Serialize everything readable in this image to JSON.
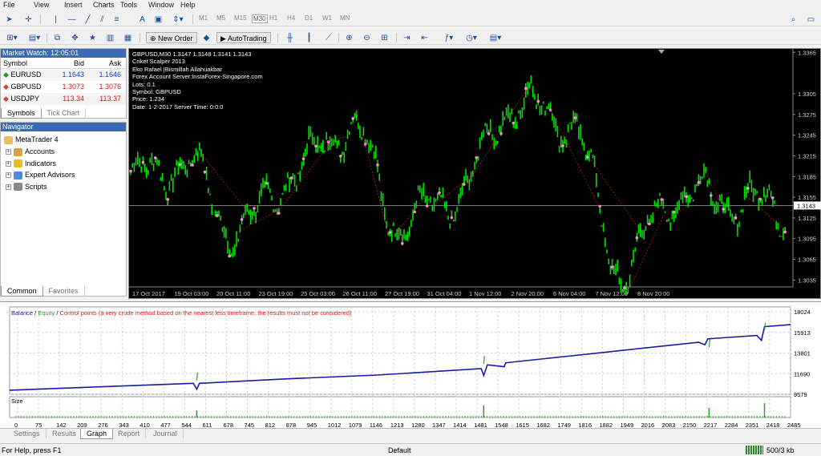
{
  "menu": [
    "File",
    "View",
    "Insert",
    "Charts",
    "Tools",
    "Window",
    "Help"
  ],
  "toolbar": {
    "timeframes": [
      "M1",
      "M5",
      "M15",
      "M30",
      "H1",
      "H4",
      "D1",
      "W1",
      "MN"
    ],
    "selected_timeframe": "M30",
    "new_order_label": "New Order",
    "autotrading_label": "AutoTrading"
  },
  "market_watch": {
    "title": "Market Watch: 12:05:01",
    "columns": [
      "Symbol",
      "Bid",
      "Ask"
    ],
    "rows": [
      {
        "symbol": "EURUSD",
        "bid": "1.1643",
        "ask": "1.1646",
        "trend": "up"
      },
      {
        "symbol": "GBPUSD",
        "bid": "1.3073",
        "ask": "1.3076",
        "trend": "down"
      },
      {
        "symbol": "USDJPY",
        "bid": "113.34",
        "ask": "113.37",
        "trend": "down"
      }
    ],
    "tabs": [
      "Symbols",
      "Tick Chart"
    ]
  },
  "navigator": {
    "title": "Navigator",
    "root": "MetaTrader 4",
    "items": [
      {
        "label": "Accounts",
        "icon": "accounts-icon"
      },
      {
        "label": "Indicators",
        "icon": "indicators-icon"
      },
      {
        "label": "Expert Advisors",
        "icon": "expert-advisors-icon"
      },
      {
        "label": "Scripts",
        "icon": "scripts-icon"
      }
    ],
    "tabs": [
      "Common",
      "Favorites"
    ]
  },
  "chart": {
    "header": "GBPUSD,M30  1.3147 1.3148 1.3141 1.3143",
    "info_lines": [
      "Criket Scalper 2013",
      "Eko Rafael |Bismillah Allahuakbar",
      "Forex Account Server:InstaForex-Singapore.com",
      "Lots:  0.1",
      "Symbol: GBPUSD",
      "Price:  1.234",
      "Date: 1-2-2017 Server Time: 0:0:0"
    ],
    "current_price": "1.3143",
    "colors": {
      "up": "#00e000",
      "down": "#00e000",
      "marker": "#ff8ad8",
      "trade_line": "#ff2020",
      "price_line": "#c0c0c0"
    }
  },
  "chart_data": [
    {
      "type": "line",
      "title": "GBPUSD,M30",
      "x": [
        "17 Oct 2017",
        "19 Oct 03:00",
        "20 Oct 11:00",
        "23 Oct 19:00",
        "25 Oct 03:00",
        "26 Oct 11:00",
        "27 Oct 19:00",
        "31 Oct 04:00",
        "1 Nov 12:00",
        "2 Nov 20:00",
        "6 Nov 04:00",
        "7 Nov 12:00",
        "8 Nov 20:00"
      ],
      "series": [
        {
          "values": [
            1.318,
            1.3205,
            1.3105,
            1.319,
            1.326,
            1.3115,
            1.316,
            1.329,
            1.327,
            1.305,
            1.316,
            1.315,
            1.314
          ]
        }
      ],
      "yticks": [
        "1.3365",
        "1.3305",
        "1.3275",
        "1.3245",
        "1.3215",
        "1.3185",
        "1.3155",
        "1.3125",
        "1.3095",
        "1.3065",
        "1.3035"
      ],
      "ylim": [
        1.3025,
        1.337
      ],
      "current_price": 1.3143
    },
    {
      "type": "line",
      "title": "",
      "legend": [
        "Balance",
        "Equity",
        "Control points (a very crude method based on the nearest less timeframe, the results must not be considered)"
      ],
      "legend_colors": [
        "#1a1aa8",
        "#2aa02a",
        "#d02020"
      ],
      "xticks": [
        "0",
        "75",
        "142",
        "209",
        "276",
        "343",
        "410",
        "477",
        "544",
        "611",
        "678",
        "745",
        "812",
        "878",
        "945",
        "1012",
        "1079",
        "1146",
        "1213",
        "1280",
        "1347",
        "1414",
        "1481",
        "1548",
        "1615",
        "1682",
        "1749",
        "1816",
        "1882",
        "1949",
        "2016",
        "2083",
        "2150",
        "2217",
        "2284",
        "2351",
        "2418",
        "2485"
      ],
      "yticks": [
        "18024",
        "15913",
        "13801",
        "11690",
        "9579"
      ],
      "ylim": [
        9579,
        18024
      ],
      "xlim": [
        0,
        2550
      ],
      "series": [
        {
          "name": "Balance",
          "x": [
            0,
            300,
            600,
            611,
            620,
            900,
            1200,
            1540,
            1548,
            1560,
            1615,
            1620,
            2250,
            2270,
            2280,
            2440,
            2455,
            2465,
            2550
          ],
          "values": [
            10000,
            10350,
            10700,
            10100,
            10700,
            11150,
            11550,
            12200,
            11500,
            12600,
            12400,
            12800,
            14900,
            14650,
            15250,
            15600,
            15100,
            16500,
            16700
          ]
        },
        {
          "name": "Size",
          "x": [
            611,
            1548,
            2284,
            2465
          ],
          "values": [
            0.3,
            0.5,
            0.4,
            0.6
          ]
        }
      ],
      "size_label": "Size"
    }
  ],
  "tester": {
    "tabs": [
      "Settings",
      "Results",
      "Graph",
      "Report",
      "Journal"
    ],
    "active_tab": "Graph"
  },
  "status": {
    "help": "For Help, press F1",
    "profile": "Default",
    "traffic": "500/3 kb"
  }
}
